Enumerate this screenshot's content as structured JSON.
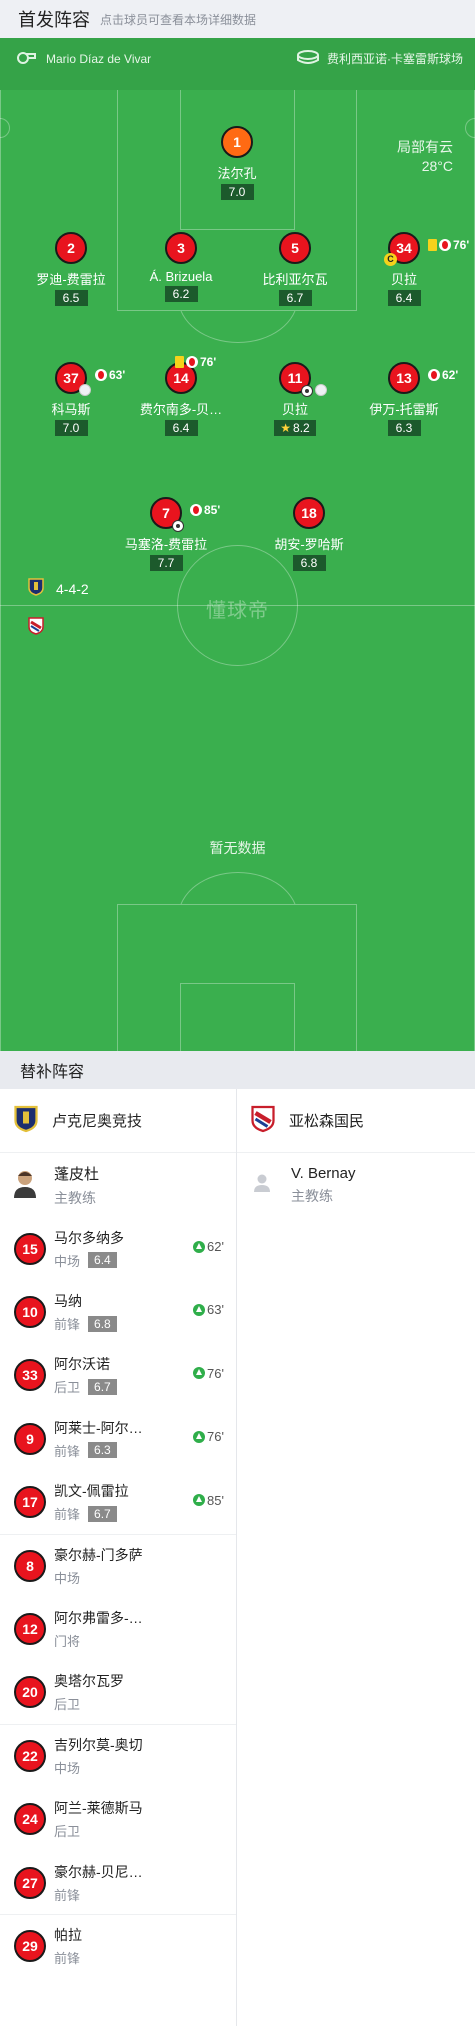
{
  "header": {
    "title": "首发阵容",
    "subtitle": "点击球员可查看本场详细数据"
  },
  "match": {
    "referee": "Mario Díaz de Vivar",
    "stadium": "费利西亚诺·卡塞雷斯球场",
    "weather": "局部有云",
    "temperature": "28°C"
  },
  "formation": "4-4-2",
  "watermark": "懂球帝",
  "away_no_data": "暂无数据",
  "players": [
    {
      "number": "1",
      "name": "法尔孔",
      "rating": "7.0"
    },
    {
      "number": "2",
      "name": "罗迪-费雷拉",
      "rating": "6.5"
    },
    {
      "number": "3",
      "name": "Á. Brizuela",
      "rating": "6.2"
    },
    {
      "number": "5",
      "name": "比利亚尔瓦",
      "rating": "6.7"
    },
    {
      "number": "34",
      "name": "贝拉",
      "rating": "6.4",
      "event": "76'",
      "captain": "C"
    },
    {
      "number": "37",
      "name": "科马斯",
      "rating": "7.0",
      "event": "63'"
    },
    {
      "number": "14",
      "name": "费尔南多-贝…",
      "rating": "6.4",
      "event": "76'"
    },
    {
      "number": "11",
      "name": "贝拉",
      "rating": "8.2"
    },
    {
      "number": "13",
      "name": "伊万-托雷斯",
      "rating": "6.3",
      "event": "62'"
    },
    {
      "number": "7",
      "name": "马塞洛-费雷拉",
      "rating": "7.7",
      "event": "85'"
    },
    {
      "number": "18",
      "name": "胡安-罗哈斯",
      "rating": "6.8"
    }
  ],
  "subs": {
    "title": "替补阵容",
    "home": {
      "team": "卢克尼奥竞技",
      "coach": {
        "name": "蓬皮杜",
        "role": "主教练"
      },
      "players": [
        {
          "number": "15",
          "name": "马尔多纳多",
          "pos": "中场",
          "rating": "6.4",
          "minute": "62'"
        },
        {
          "number": "10",
          "name": "马纳",
          "pos": "前锋",
          "rating": "6.8",
          "minute": "63'"
        },
        {
          "number": "33",
          "name": "阿尔沃诺",
          "pos": "后卫",
          "rating": "6.7",
          "minute": "76'"
        },
        {
          "number": "9",
          "name": "阿莱士-阿尔…",
          "pos": "前锋",
          "rating": "6.3",
          "minute": "76'"
        },
        {
          "number": "17",
          "name": "凯文-佩雷拉",
          "pos": "前锋",
          "rating": "6.7",
          "minute": "85'"
        },
        {
          "number": "8",
          "name": "豪尔赫-门多萨",
          "pos": "中场"
        },
        {
          "number": "12",
          "name": "阿尔弗雷多-…",
          "pos": "门将"
        },
        {
          "number": "20",
          "name": "奥塔尔瓦罗",
          "pos": "后卫"
        },
        {
          "number": "22",
          "name": "吉列尔莫-奥切",
          "pos": "中场"
        },
        {
          "number": "24",
          "name": "阿兰-莱德斯马",
          "pos": "后卫"
        },
        {
          "number": "27",
          "name": "豪尔赫-贝尼…",
          "pos": "前锋"
        },
        {
          "number": "29",
          "name": "帕拉",
          "pos": "前锋"
        }
      ]
    },
    "away": {
      "team": "亚松森国民",
      "coach": {
        "name": "V. Bernay",
        "role": "主教练"
      }
    }
  }
}
